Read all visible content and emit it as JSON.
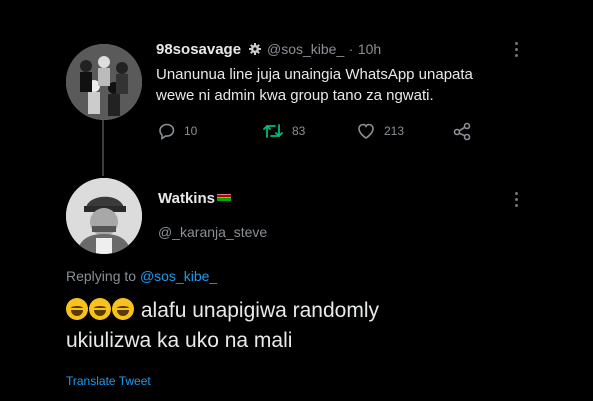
{
  "original_tweet": {
    "display_name": "98sosavage",
    "handle": "@sos_kibe_",
    "time": "10h",
    "separator": "·",
    "text_line1": "Unanunua line juja unaingia WhatsApp unapata",
    "text_line2": "wewe ni admin kwa group tano za ngwati.",
    "reply_count": "10",
    "retweet_count": "83",
    "like_count": "213",
    "icons": {
      "verified": "gear-badge-icon",
      "reply": "reply-icon",
      "retweet": "retweet-icon",
      "like": "heart-icon",
      "share": "share-icon",
      "more": "more-vertical-icon"
    }
  },
  "reply_tweet": {
    "display_name": "Watkins",
    "flag": "kenya-flag-icon",
    "handle": "@_karanja_steve",
    "replying_prefix": "Replying to",
    "replying_handle": "@sos_kibe_",
    "emoji": "grinning-sweat-emoji",
    "emoji_count": 3,
    "text_line1": "alafu unapigiwa randomly",
    "text_line2": "ukiulizwa ka uko na mali",
    "translate_label": "Translate Tweet"
  },
  "colors": {
    "background": "#000000",
    "text": "#e7e9ea",
    "muted": "#8b9096",
    "link": "#1d9bf0",
    "retweet_green": "#00ba7c"
  }
}
